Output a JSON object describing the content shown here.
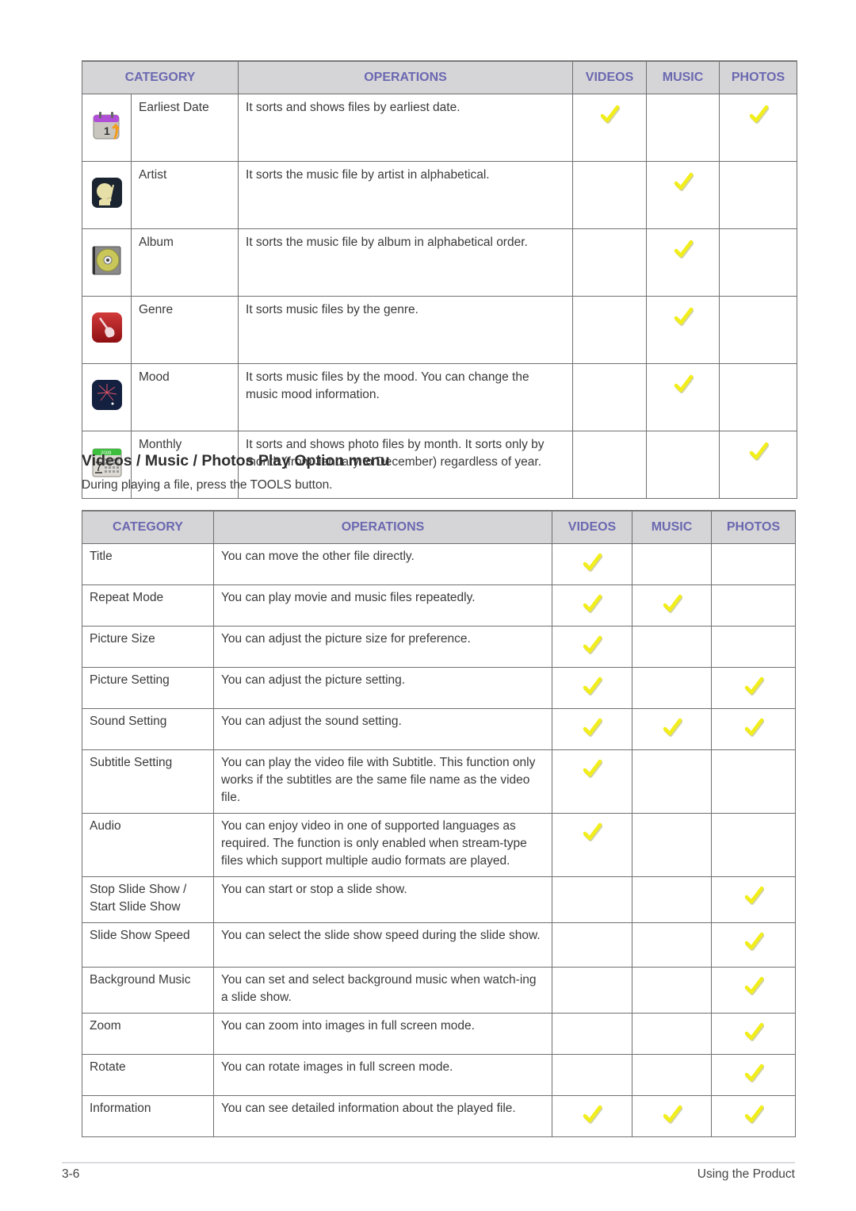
{
  "table1": {
    "headers": {
      "category": "CATEGORY",
      "operations": "OPERATIONS",
      "videos": "VIDEOS",
      "music": "MUSIC",
      "photos": "PHOTOS"
    },
    "rows": [
      {
        "icon": "calendar-sort-icon",
        "category": "Earliest Date",
        "operation": "It sorts and shows files by earliest date.",
        "videos": true,
        "music": false,
        "photos": true
      },
      {
        "icon": "artist-icon",
        "category": "Artist",
        "operation": "It sorts the music file by artist in alphabetical.",
        "videos": false,
        "music": true,
        "photos": false
      },
      {
        "icon": "album-cd-icon",
        "category": "Album",
        "operation": "It sorts the music file by album in alphabetical order.",
        "videos": false,
        "music": true,
        "photos": false
      },
      {
        "icon": "guitar-icon",
        "category": "Genre",
        "operation": "It sorts music files by the genre.",
        "videos": false,
        "music": true,
        "photos": false
      },
      {
        "icon": "fireworks-icon",
        "category": "Mood",
        "operation": "It sorts music files by the mood. You can change the music mood information.",
        "videos": false,
        "music": true,
        "photos": false
      },
      {
        "icon": "monthly-calendar-icon",
        "category": "Monthly",
        "operation": "It sorts and shows photo files by month. It sorts only by month (from January to December) regardless of year.",
        "videos": false,
        "music": false,
        "photos": true
      }
    ]
  },
  "section": {
    "title": "Videos / Music / Photos Play Option menu",
    "intro": "During playing a file, press the TOOLS button."
  },
  "table2": {
    "headers": {
      "category": "CATEGORY",
      "operations": "OPERATIONS",
      "videos": "VIDEOS",
      "music": "MUSIC",
      "photos": "PHOTOS"
    },
    "rows": [
      {
        "category": "Title",
        "operation": "You can move the other file directly.",
        "videos": true,
        "music": false,
        "photos": false
      },
      {
        "category": "Repeat Mode",
        "operation": "You can play movie and music files repeatedly.",
        "videos": true,
        "music": true,
        "photos": false
      },
      {
        "category": "Picture Size",
        "operation": "You can adjust the picture size for preference.",
        "videos": true,
        "music": false,
        "photos": false
      },
      {
        "category": "Picture Setting",
        "operation": "You can adjust the picture setting.",
        "videos": true,
        "music": false,
        "photos": true
      },
      {
        "category": "Sound Setting",
        "operation": "You can adjust the sound setting.",
        "videos": true,
        "music": true,
        "photos": true
      },
      {
        "category": "Subtitle Setting",
        "operation": "You can play the video file with Subtitle. This function only works if the subtitles are the same file name as the video file.",
        "videos": true,
        "music": false,
        "photos": false
      },
      {
        "category": "Audio",
        "operation": "You can enjoy video in one of supported languages as required. The function is only enabled when stream-type files which support multiple audio formats are played.",
        "videos": true,
        "music": false,
        "photos": false
      },
      {
        "category": "Stop Slide Show / Start Slide Show",
        "operation": "You can start or stop a slide show.",
        "videos": false,
        "music": false,
        "photos": true
      },
      {
        "category": "Slide Show Speed",
        "operation": "You can select the slide show speed during the slide show.",
        "videos": false,
        "music": false,
        "photos": true
      },
      {
        "category": "Background Music",
        "operation": "You can set and select background music when watch-ing a slide show.",
        "videos": false,
        "music": false,
        "photos": true
      },
      {
        "category": "Zoom",
        "operation": "You can zoom into images in full screen mode.",
        "videos": false,
        "music": false,
        "photos": true
      },
      {
        "category": "Rotate",
        "operation": "You can rotate images in full screen mode.",
        "videos": false,
        "music": false,
        "photos": true
      },
      {
        "category": "Information",
        "operation": "You can see detailed information about the played file.",
        "videos": true,
        "music": true,
        "photos": true
      }
    ]
  },
  "footer": {
    "page_number": "3-6",
    "section_name": "Using the Product"
  },
  "colors": {
    "header_text": "#6b68b0",
    "header_bg": "#d5d5d8",
    "check_yellow": "#f2ee1a"
  }
}
